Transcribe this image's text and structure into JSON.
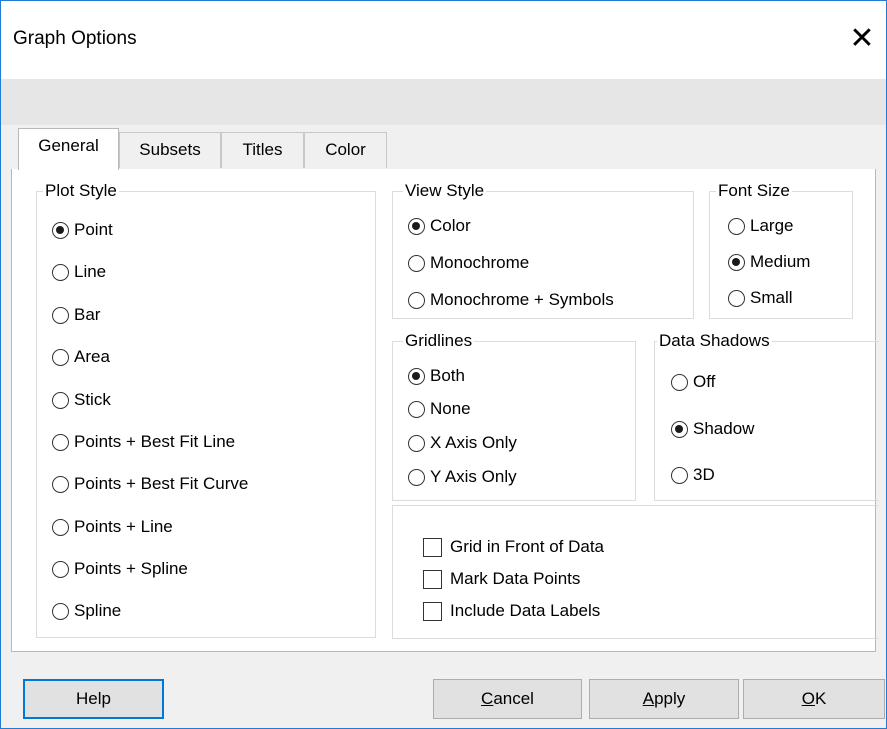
{
  "window": {
    "title": "Graph Options",
    "close_glyph": "✕"
  },
  "tabs": [
    {
      "label": "General",
      "active": true
    },
    {
      "label": "Subsets",
      "active": false
    },
    {
      "label": "Titles",
      "active": false
    },
    {
      "label": "Color",
      "active": false
    }
  ],
  "plot_style": {
    "legend": "Plot Style",
    "options": [
      "Point",
      "Line",
      "Bar",
      "Area",
      "Stick",
      "Points + Best Fit Line",
      "Points + Best Fit Curve",
      "Points + Line",
      "Points + Spline",
      "Spline"
    ],
    "selected": "Point"
  },
  "view_style": {
    "legend": "View Style",
    "options": [
      "Color",
      "Monochrome",
      "Monochrome + Symbols"
    ],
    "selected": "Color"
  },
  "font_size": {
    "legend": "Font Size",
    "options": [
      "Large",
      "Medium",
      "Small"
    ],
    "selected": "Medium"
  },
  "gridlines": {
    "legend": "Gridlines",
    "options": [
      "Both",
      "None",
      "X Axis Only",
      "Y Axis Only"
    ],
    "selected": "Both"
  },
  "data_shadows": {
    "legend": "Data Shadows",
    "options": [
      "Off",
      "Shadow",
      "3D"
    ],
    "selected": "Shadow"
  },
  "checkboxes": [
    {
      "label": "Grid in Front of Data",
      "checked": false
    },
    {
      "label": "Mark Data Points",
      "checked": false
    },
    {
      "label": "Include Data Labels",
      "checked": false
    }
  ],
  "buttons": {
    "help": "Help",
    "cancel_accel": "C",
    "cancel_rest": "ancel",
    "apply_accel": "A",
    "apply_rest": "pply",
    "ok_accel": "O",
    "ok_rest": "K"
  }
}
